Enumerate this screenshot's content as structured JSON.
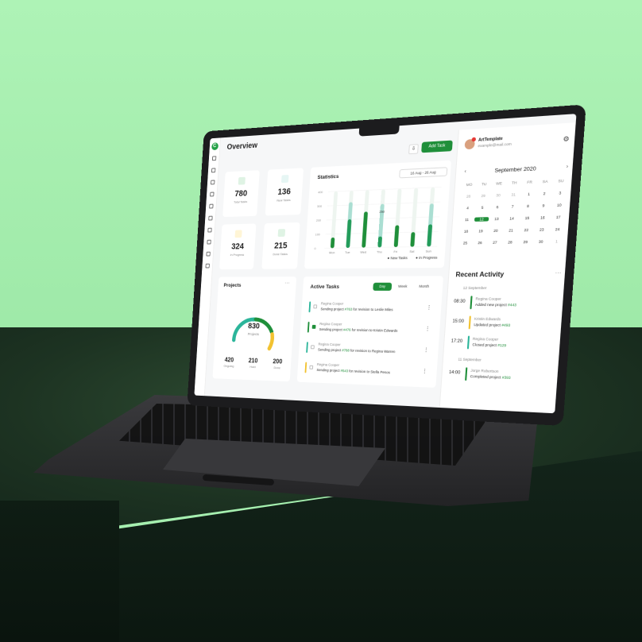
{
  "app": {
    "page_title": "Overview",
    "download_icon": "download-icon",
    "add_task_label": "Add Task",
    "logo_icon": "app-logo-icon"
  },
  "sidebar": {
    "icons": [
      "grid-icon",
      "cart-icon",
      "box-icon",
      "mail-icon",
      "users-icon",
      "clipboard-icon",
      "layers-icon",
      "folder-icon",
      "document-icon",
      "tablet-icon"
    ]
  },
  "stats": [
    {
      "value": "780",
      "label": "Total Tasks",
      "icon": "clipboard-icon",
      "color": "#dff3e4",
      "icon_color": "#1f8f3a"
    },
    {
      "value": "136",
      "label": "New Tasks",
      "icon": "sparkle-icon",
      "color": "#e6f6f4",
      "icon_color": "#26a69a"
    },
    {
      "value": "324",
      "label": "In Progress",
      "icon": "hourglass-icon",
      "color": "#fff5d6",
      "icon_color": "#f2b705"
    },
    {
      "value": "215",
      "label": "Done Tasks",
      "icon": "check-clipboard-icon",
      "color": "#dff3e4",
      "icon_color": "#1f8f3a"
    }
  ],
  "statistics": {
    "title": "Statistics",
    "range": "16 Aug - 26 Aug",
    "tooltip": "250",
    "legend": [
      "New Tasks",
      "In Progress"
    ]
  },
  "chart_data": {
    "type": "bar",
    "categories": [
      "Mon",
      "Tue",
      "Wed",
      "Thu",
      "Fri",
      "Sat",
      "Sun"
    ],
    "series": [
      {
        "name": "New Tasks",
        "values": [
          75,
          200,
          250,
          75,
          150,
          100,
          150
        ],
        "color": "#1f8f3a"
      },
      {
        "name": "In Progress",
        "values": [
          0,
          320,
          0,
          300,
          0,
          0,
          290
        ],
        "color": "#2bb59a"
      }
    ],
    "y_ticks": [
      "0",
      "100",
      "200",
      "300",
      "400"
    ],
    "ylim": [
      0,
      400
    ]
  },
  "projects": {
    "title": "Projects",
    "total": "830",
    "total_label": "Projects",
    "items": [
      {
        "value": "420",
        "label": "Ongoing",
        "color": "#2bb59a"
      },
      {
        "value": "210",
        "label": "Hold",
        "color": "#1f8f3a"
      },
      {
        "value": "200",
        "label": "Done",
        "color": "#f2c230"
      }
    ]
  },
  "active_tasks": {
    "title": "Active Tasks",
    "tabs": [
      "Day",
      "Week",
      "Month"
    ],
    "items": [
      {
        "name": "Regina Cooper",
        "prefix": "Sending project ",
        "tag": "#763",
        "suffix": " for revision to Leslie Miles",
        "checked": false,
        "color": "#2bb59a"
      },
      {
        "name": "Regina Cooper",
        "prefix": "Sending project ",
        "tag": "#476",
        "suffix": " for revision to Kristin Edwards",
        "checked": true,
        "color": "#1f8f3a"
      },
      {
        "name": "Regina Cooper",
        "prefix": "Sending project ",
        "tag": "#788",
        "suffix": " for revision to Regina Warren",
        "checked": false,
        "color": "#2bb59a"
      },
      {
        "name": "Regina Cooper",
        "prefix": "Sending project ",
        "tag": "#543",
        "suffix": " for revision to Stella Penos",
        "checked": false,
        "color": "#f2c230"
      }
    ]
  },
  "user": {
    "name": "ArtTemplate",
    "email": "example@mail.com",
    "settings_icon": "gear-icon"
  },
  "calendar": {
    "month": "September",
    "year": "2020",
    "prev_icon": "chevron-left-icon",
    "next_icon": "chevron-right-icon",
    "day_names": [
      "MO",
      "TU",
      "WE",
      "TH",
      "FR",
      "SA",
      "SU"
    ],
    "days": [
      {
        "d": "28",
        "m": true
      },
      {
        "d": "29",
        "m": true
      },
      {
        "d": "30",
        "m": true
      },
      {
        "d": "31",
        "m": true
      },
      {
        "d": "1"
      },
      {
        "d": "2"
      },
      {
        "d": "3"
      },
      {
        "d": "4"
      },
      {
        "d": "5"
      },
      {
        "d": "6"
      },
      {
        "d": "7"
      },
      {
        "d": "8"
      },
      {
        "d": "9"
      },
      {
        "d": "10"
      },
      {
        "d": "11"
      },
      {
        "d": "12",
        "t": true
      },
      {
        "d": "13"
      },
      {
        "d": "14"
      },
      {
        "d": "15"
      },
      {
        "d": "16"
      },
      {
        "d": "17"
      },
      {
        "d": "18"
      },
      {
        "d": "19"
      },
      {
        "d": "20"
      },
      {
        "d": "21"
      },
      {
        "d": "22"
      },
      {
        "d": "23"
      },
      {
        "d": "24"
      },
      {
        "d": "25"
      },
      {
        "d": "26"
      },
      {
        "d": "27"
      },
      {
        "d": "28"
      },
      {
        "d": "29"
      },
      {
        "d": "30"
      },
      {
        "d": "1",
        "m": true
      }
    ]
  },
  "recent_activity": {
    "title": "Recent Activity",
    "groups": [
      {
        "date": "12 September",
        "items": [
          {
            "time": "08:30",
            "name": "Regina Cooper",
            "prefix": "Added new project ",
            "tag": "#443",
            "color": "#1f8f3a"
          },
          {
            "time": "15:00",
            "name": "Kristin Edwards",
            "prefix": "Updated project ",
            "tag": "#493",
            "color": "#f2c230"
          },
          {
            "time": "17:20",
            "name": "Regina Cooper",
            "prefix": "Closed project ",
            "tag": "#129",
            "color": "#2bb59a"
          }
        ]
      },
      {
        "date": "11 September",
        "items": [
          {
            "time": "14:00",
            "name": "Jorge Robertson",
            "prefix": "Completed project ",
            "tag": "#393",
            "color": "#1f8f3a"
          }
        ]
      }
    ]
  }
}
